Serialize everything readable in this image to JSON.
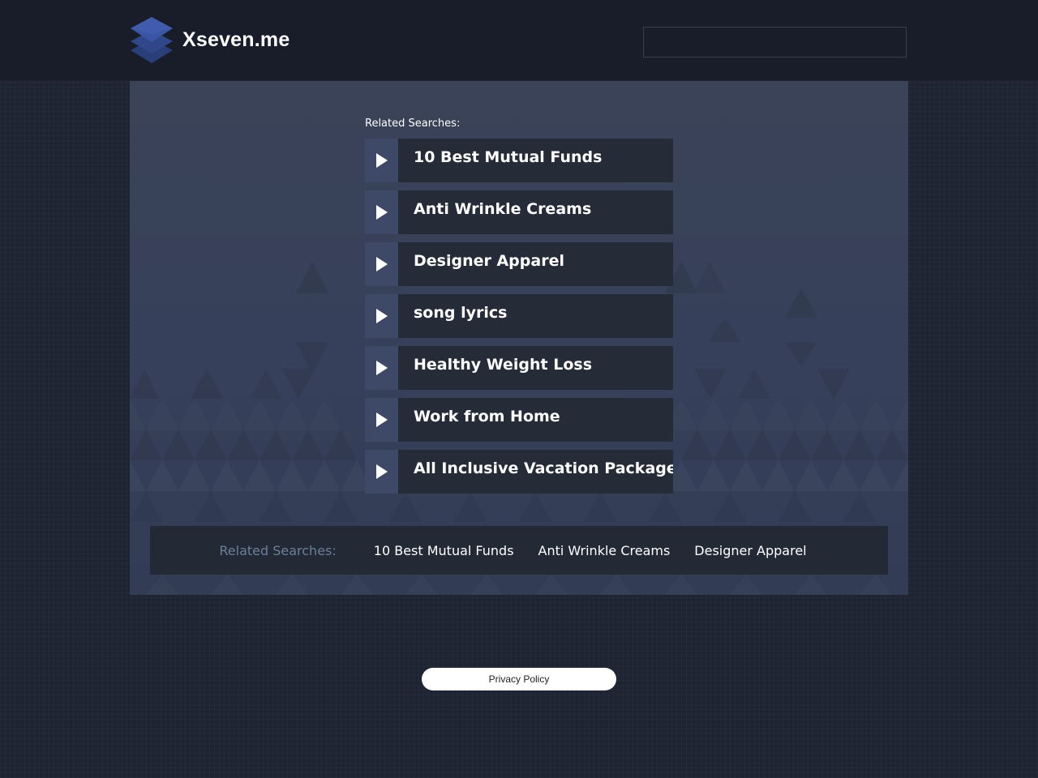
{
  "header": {
    "logo_icon": "stacked-layers-icon",
    "site_name": "Xseven.me",
    "search": {
      "value": "",
      "placeholder": ""
    }
  },
  "main": {
    "related_label": "Related Searches:",
    "item_icon": "play-arrow-icon",
    "items": [
      {
        "label": "10 Best Mutual Funds"
      },
      {
        "label": "Anti Wrinkle Creams"
      },
      {
        "label": "Designer Apparel"
      },
      {
        "label": "song lyrics"
      },
      {
        "label": "Healthy Weight Loss"
      },
      {
        "label": "Work from Home"
      },
      {
        "label": "All Inclusive Vacation Packages"
      }
    ]
  },
  "bottom_bar": {
    "label": "Related Searches:",
    "links": [
      {
        "label": "10 Best Mutual Funds"
      },
      {
        "label": "Anti Wrinkle Creams"
      },
      {
        "label": "Designer Apparel"
      }
    ]
  },
  "footer": {
    "privacy_label": "Privacy Policy"
  },
  "colors": {
    "page_background": "#1f2433",
    "header_background": "#181d29",
    "panel_background": "#3a4357",
    "item_background": "#252b37",
    "arrow_block": "#3d4967",
    "muted_label": "#6b7f99"
  }
}
